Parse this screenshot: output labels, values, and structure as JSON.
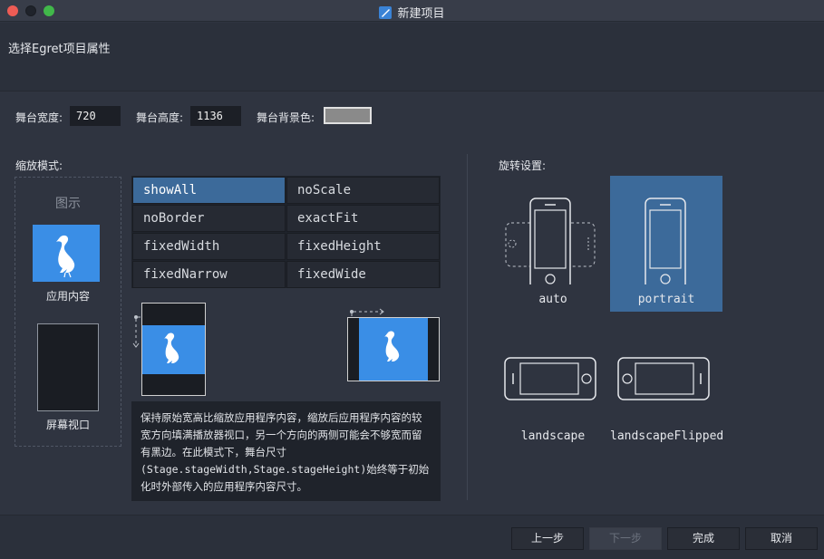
{
  "window": {
    "title": "新建项目"
  },
  "header": {
    "text": "选择Egret项目属性"
  },
  "stage": {
    "width_label": "舞台宽度:",
    "width_value": "720",
    "height_label": "舞台高度:",
    "height_value": "1136",
    "bg_label": "舞台背景色:",
    "bg_color": "#8a8a8a"
  },
  "scale": {
    "section_label": "缩放模式:",
    "preview_title": "图示",
    "app_label": "应用内容",
    "screen_label": "屏幕视口",
    "modes": [
      "showAll",
      "noScale",
      "noBorder",
      "exactFit",
      "fixedWidth",
      "fixedHeight",
      "fixedNarrow",
      "fixedWide"
    ],
    "selected": "showAll",
    "description": "保持原始宽高比缩放应用程序内容，缩放后应用程序内容的较宽方向填满播放器视口，另一个方向的两侧可能会不够宽而留有黑边。在此模式下，舞台尺寸(Stage.stageWidth,Stage.stageHeight)始终等于初始化时外部传入的应用程序内容尺寸。"
  },
  "rotation": {
    "section_label": "旋转设置:",
    "options": [
      "auto",
      "portrait",
      "landscape",
      "landscapeFlipped"
    ],
    "selected": "portrait"
  },
  "footer": {
    "prev": "上一步",
    "next": "下一步",
    "finish": "完成",
    "cancel": "取消"
  },
  "colors": {
    "accent": "#3a8ee6",
    "selected": "#3c6a9a",
    "background": "#2f3440"
  }
}
